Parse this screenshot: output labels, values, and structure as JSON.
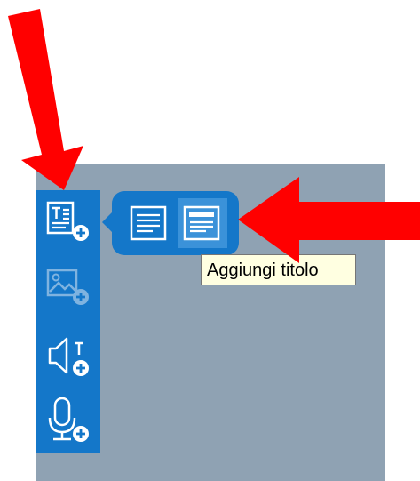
{
  "tooltip": {
    "text": "Aggiungi titolo"
  },
  "toolbar": {
    "items": [
      {
        "icon": "add-text-icon",
        "state": "active"
      },
      {
        "icon": "add-image-icon",
        "state": "disabled"
      },
      {
        "icon": "add-audio-text-icon",
        "state": "enabled"
      },
      {
        "icon": "add-voice-recording-icon",
        "state": "enabled"
      }
    ]
  },
  "popover": {
    "options": [
      {
        "icon": "text-paragraph-icon",
        "selected": false
      },
      {
        "icon": "text-title-icon",
        "selected": true
      }
    ]
  },
  "colors": {
    "canvas": "#8fa2b3",
    "toolbar": "#1477c9",
    "selected_option": "#3b92d9",
    "annotation_arrow": "#ff0000",
    "tooltip_bg": "#ffffe1"
  }
}
